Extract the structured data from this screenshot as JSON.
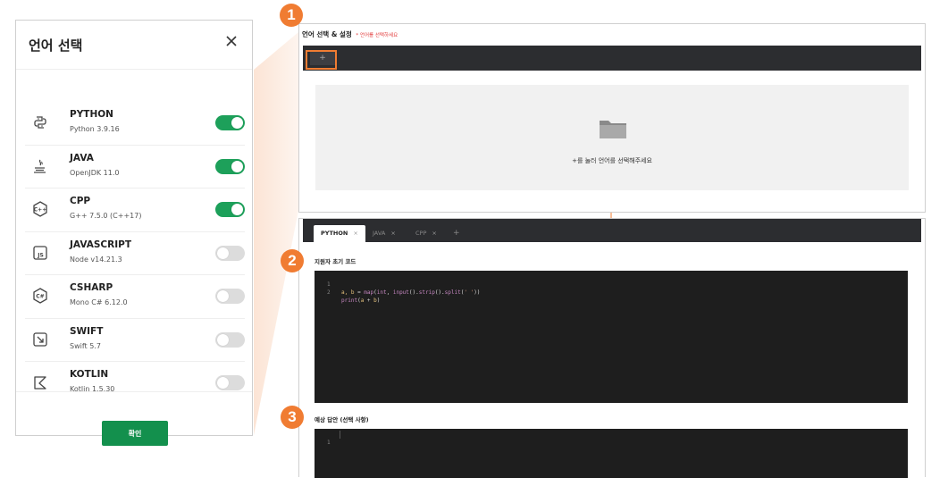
{
  "modal": {
    "title": "언어 선택",
    "close_icon": "close-icon",
    "confirm_label": "확인",
    "languages": [
      {
        "name": "PYTHON",
        "version": "Python 3.9.16",
        "enabled": true,
        "icon": "python-icon"
      },
      {
        "name": "JAVA",
        "version": "OpenJDK 11.0",
        "enabled": true,
        "icon": "java-icon"
      },
      {
        "name": "CPP",
        "version": "G++ 7.5.0 (C++17)",
        "enabled": true,
        "icon": "cpp-icon"
      },
      {
        "name": "JAVASCRIPT",
        "version": "Node v14.21.3",
        "enabled": false,
        "icon": "javascript-icon"
      },
      {
        "name": "CSHARP",
        "version": "Mono C# 6.12.0",
        "enabled": false,
        "icon": "csharp-icon"
      },
      {
        "name": "SWIFT",
        "version": "Swift 5.7",
        "enabled": false,
        "icon": "swift-icon"
      },
      {
        "name": "KOTLIN",
        "version": "Kotlin 1.5.30",
        "enabled": false,
        "icon": "kotlin-icon"
      }
    ]
  },
  "top_panel": {
    "title": "언어 선택 & 설정",
    "hint": "* 언어를 선택하세요",
    "add_button": "+",
    "empty_message": "+를 눌러 언어를 선택해주세요",
    "empty_icon": "folder-icon"
  },
  "bottom_panel": {
    "tabs": [
      {
        "label": "PYTHON",
        "active": true
      },
      {
        "label": "JAVA",
        "active": false
      },
      {
        "label": "CPP",
        "active": false
      }
    ],
    "tab_close": "×",
    "tab_add": "+",
    "initial_code_label": "지원자 초기 코드",
    "initial_code_lines": [
      {
        "num": "1",
        "text": "a, b = map(int, input().strip().split(' '))"
      },
      {
        "num": "2",
        "text": "print(a + b)"
      }
    ],
    "expected_answer_label": "예상 답안 (선택 사항)",
    "expected_answer_lines": [
      {
        "num": "1",
        "text": ""
      }
    ]
  },
  "badges": [
    "1",
    "2",
    "3"
  ],
  "colors": {
    "accent": "#f07c32",
    "toggle_on": "#1da05a",
    "toggle_off": "#dcdcdc",
    "confirm": "#13904d",
    "editor_bg": "#1e1e1e",
    "tabbar_bg": "#2c2d30"
  }
}
